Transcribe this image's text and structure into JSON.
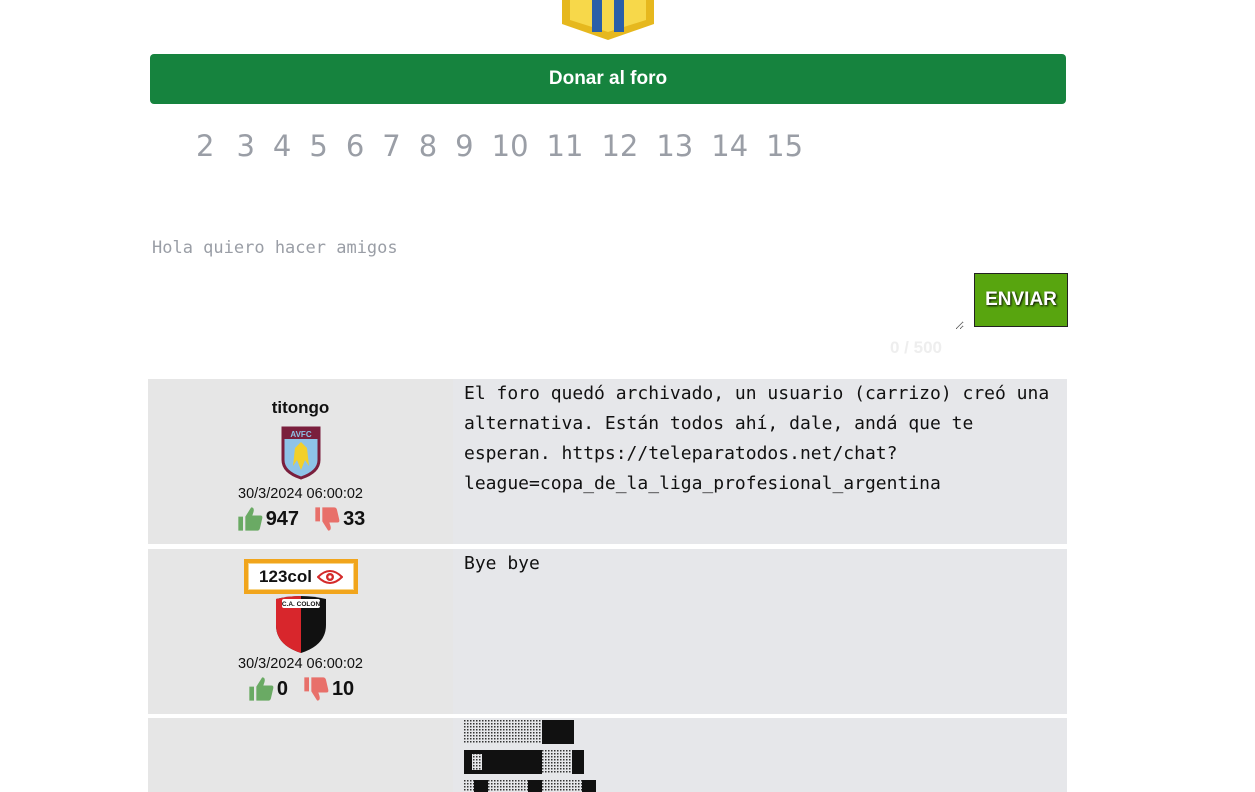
{
  "header": {
    "logo": "forum-logo-icon",
    "donate_label": "Donar al foro"
  },
  "pagination": {
    "pages": [
      "2",
      "3",
      "4",
      "5",
      "6",
      "7",
      "8",
      "9",
      "10",
      "11",
      "12",
      "13",
      "14",
      "15"
    ]
  },
  "composer": {
    "placeholder": "Hola quiero hacer amigos",
    "value": "",
    "send_label": "ENVIAR",
    "counter": "0 / 500"
  },
  "posts": [
    {
      "username": "titongo",
      "crest": "aston-villa-crest-icon",
      "date": "30/3/2024 06:00:02",
      "likes": "947",
      "dislikes": "33",
      "text": "El foro quedó archivado, un usuario (carrizo) creó una alternativa. Están todos ahí, dale, andá que te esperan. https://teleparatodos.net/chat?league=copa_de_la_liga_profesional_argentina"
    },
    {
      "username": "123col",
      "badge": "eye-icon",
      "crest": "colon-crest-icon",
      "date": "30/3/2024 06:00:02",
      "likes": "0",
      "dislikes": "10",
      "text": "Bye bye"
    },
    {
      "username": "",
      "text": ""
    }
  ],
  "colors": {
    "donate_bg": "#16833e",
    "send_bg": "#58a50f",
    "like": "#6aaa64",
    "dislike": "#e8706a",
    "badge_border": "#f1a51c"
  }
}
